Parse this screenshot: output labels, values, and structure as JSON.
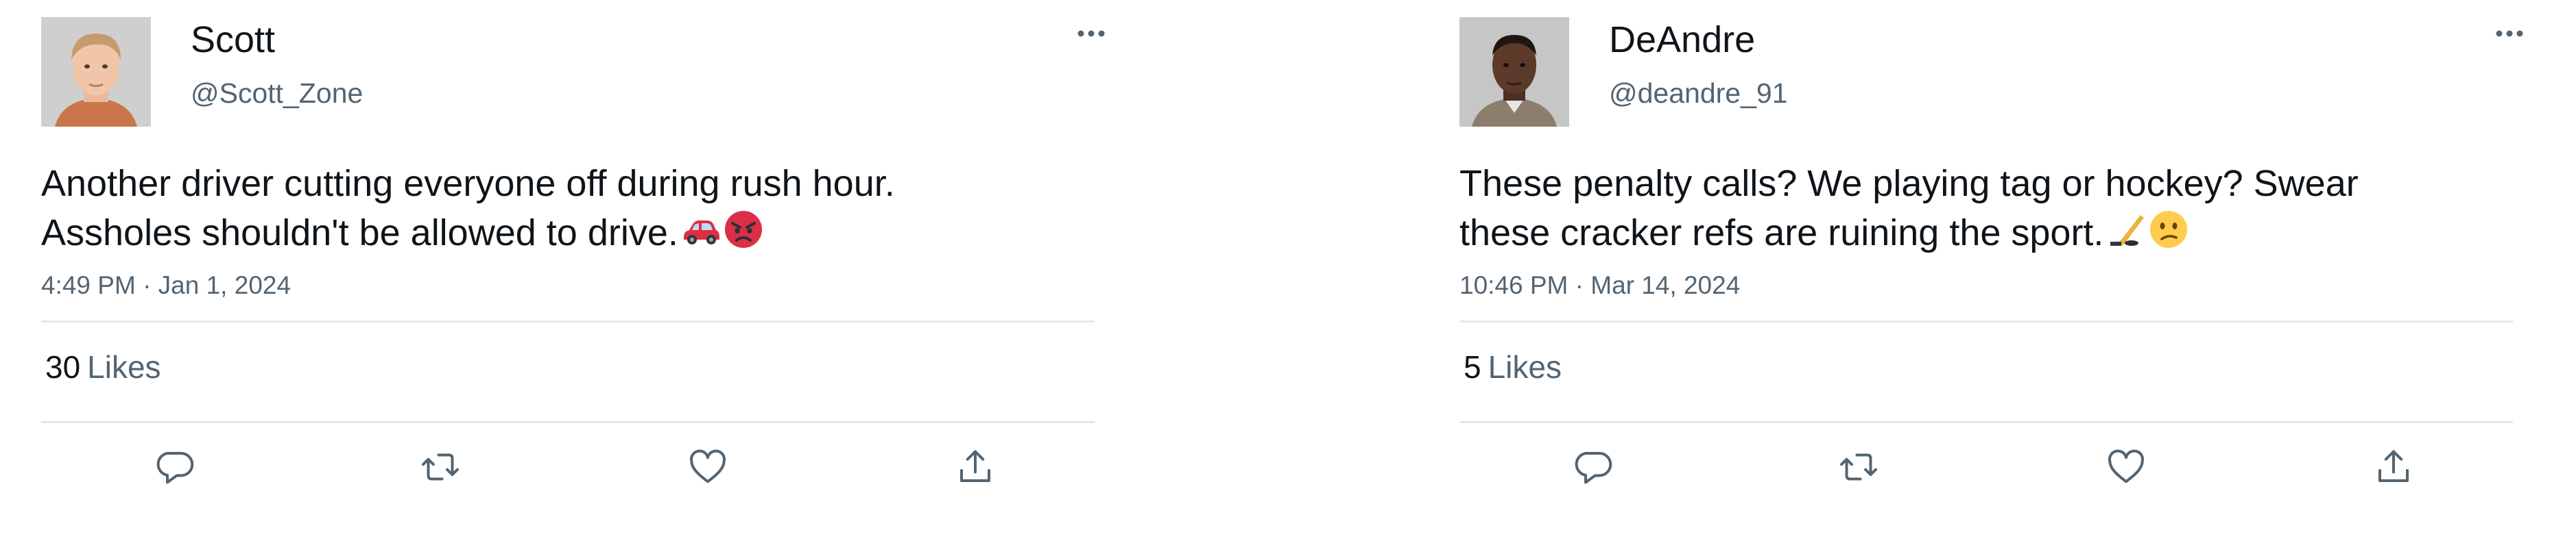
{
  "colors": {
    "text_primary": "#0f1419",
    "text_secondary": "#536471",
    "divider": "#e4e8ec"
  },
  "tweets": [
    {
      "display_name": "Scott",
      "handle": "@Scott_Zone",
      "text_line_1": "Another driver cutting everyone off during rush hour.",
      "text_line_2": "Assholes shouldn't be allowed to drive.",
      "emojis": [
        "car-emoji",
        "angry-face-emoji"
      ],
      "timestamp": "4:49 PM · Jan 1, 2024",
      "likes_count": "30",
      "likes_label": "Likes",
      "avatar_icon": "young-man-portrait",
      "actions": [
        "reply-icon",
        "retweet-icon",
        "like-icon",
        "share-icon"
      ]
    },
    {
      "display_name": "DeAndre",
      "handle": "@deandre_91",
      "text_line_1": "These penalty calls? We playing tag or hockey? Swear",
      "text_line_2": "these cracker refs are ruining the sport.",
      "emojis": [
        "hockey-stick-emoji",
        "confused-face-emoji"
      ],
      "timestamp": "10:46 PM · Mar 14, 2024",
      "likes_count": "5",
      "likes_label": "Likes",
      "avatar_icon": "man-portrait",
      "actions": [
        "reply-icon",
        "retweet-icon",
        "like-icon",
        "share-icon"
      ]
    }
  ]
}
